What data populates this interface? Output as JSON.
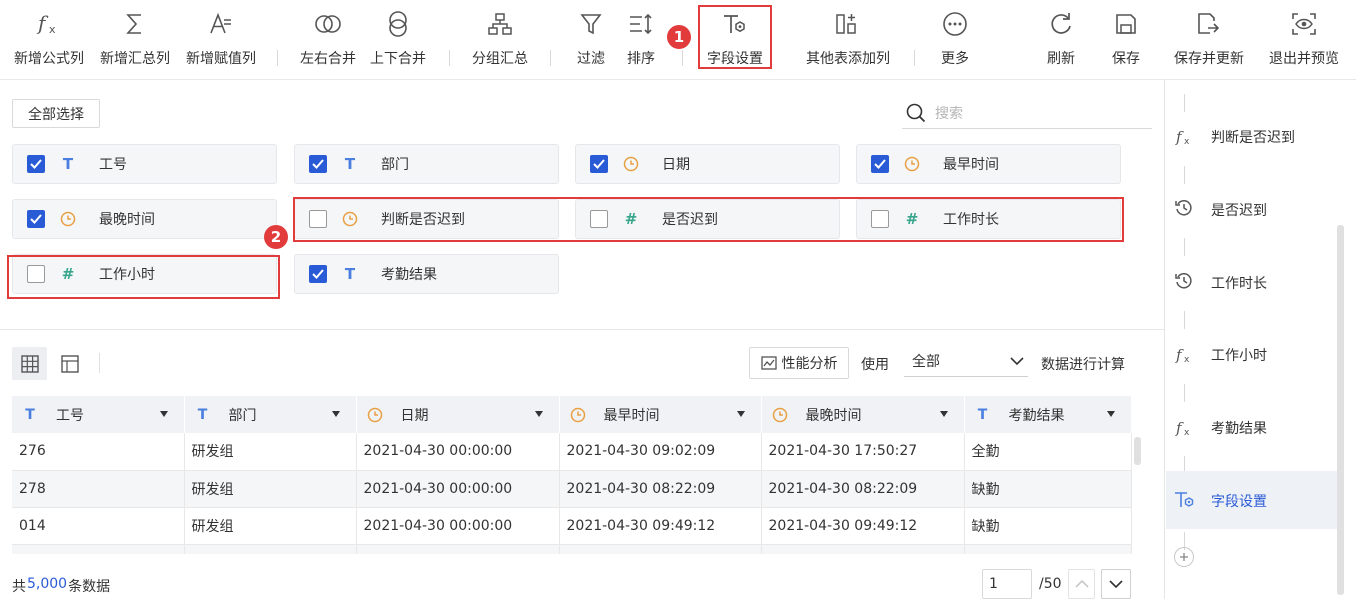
{
  "toolbar": {
    "items": [
      {
        "label": "新增公式列",
        "icon": "fx-icon"
      },
      {
        "label": "新增汇总列",
        "icon": "sigma-icon"
      },
      {
        "label": "新增赋值列",
        "icon": "assign-icon"
      },
      {
        "label": "左右合并",
        "icon": "merge-horizontal-icon"
      },
      {
        "label": "上下合并",
        "icon": "merge-vertical-icon"
      },
      {
        "label": "分组汇总",
        "icon": "group-icon"
      },
      {
        "label": "过滤",
        "icon": "filter-icon"
      },
      {
        "label": "排序",
        "icon": "sort-icon"
      },
      {
        "label": "字段设置",
        "icon": "field-settings-icon"
      },
      {
        "label": "其他表添加列",
        "icon": "add-column-icon"
      },
      {
        "label": "更多",
        "icon": "more-icon"
      },
      {
        "label": "刷新",
        "icon": "refresh-icon"
      },
      {
        "label": "保存",
        "icon": "save-icon"
      },
      {
        "label": "保存并更新",
        "icon": "save-update-icon"
      },
      {
        "label": "退出并预览",
        "icon": "preview-icon"
      }
    ]
  },
  "badges": {
    "one": "1",
    "two": "2"
  },
  "fields_panel": {
    "select_all_label": "全部选择",
    "search_placeholder": "搜索",
    "fields": [
      {
        "name": "工号",
        "type": "text",
        "checked": true
      },
      {
        "name": "部门",
        "type": "text",
        "checked": true
      },
      {
        "name": "日期",
        "type": "date",
        "checked": true
      },
      {
        "name": "最早时间",
        "type": "date",
        "checked": true
      },
      {
        "name": "最晚时间",
        "type": "date",
        "checked": true
      },
      {
        "name": "判断是否迟到",
        "type": "date",
        "checked": false
      },
      {
        "name": "是否迟到",
        "type": "number",
        "checked": false
      },
      {
        "name": "工作时长",
        "type": "number",
        "checked": false
      },
      {
        "name": "工作小时",
        "type": "number",
        "checked": false
      },
      {
        "name": "考勤结果",
        "type": "text",
        "checked": true
      }
    ]
  },
  "preview": {
    "perf_label": "性能分析",
    "use_label": "使用",
    "use_value": "全部",
    "compute_label": "数据进行计算",
    "columns": [
      {
        "name": "工号",
        "type": "text"
      },
      {
        "name": "部门",
        "type": "text"
      },
      {
        "name": "日期",
        "type": "date"
      },
      {
        "name": "最早时间",
        "type": "date"
      },
      {
        "name": "最晚时间",
        "type": "date"
      },
      {
        "name": "考勤结果",
        "type": "text"
      }
    ],
    "rows": [
      [
        "276",
        "研发组",
        "2021-04-30 00:00:00",
        "2021-04-30 09:02:09",
        "2021-04-30 17:50:27",
        "全勤"
      ],
      [
        "278",
        "研发组",
        "2021-04-30 00:00:00",
        "2021-04-30 08:22:09",
        "2021-04-30 08:22:09",
        "缺勤"
      ],
      [
        "014",
        "研发组",
        "2021-04-30 00:00:00",
        "2021-04-30 09:49:12",
        "2021-04-30 09:49:12",
        "缺勤"
      ],
      [
        "",
        "",
        "",
        "",
        "",
        ""
      ]
    ],
    "total_prefix": "共",
    "total_count": "5,000",
    "total_suffix": "条数据",
    "page_value": "1",
    "page_total": "/50"
  },
  "steps": [
    {
      "label": "判断是否迟到",
      "icon": "fx-icon"
    },
    {
      "label": "是否迟到",
      "icon": "history-icon"
    },
    {
      "label": "工作时长",
      "icon": "history-icon"
    },
    {
      "label": "工作小时",
      "icon": "fx-icon"
    },
    {
      "label": "考勤结果",
      "icon": "fx-icon"
    },
    {
      "label": "字段设置",
      "icon": "field-settings-icon"
    }
  ],
  "colors": {
    "accent": "#2a5bd7",
    "highlight": "#e23b3b",
    "date": "#e8a045",
    "number": "#37a68d",
    "text": "#4a7fe0"
  }
}
